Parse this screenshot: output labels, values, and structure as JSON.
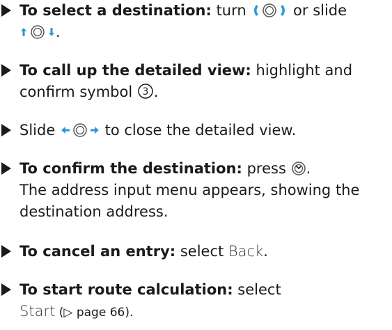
{
  "steps": [
    {
      "bold": "To select a destination:",
      "text1": " turn ",
      "text2": " or slide",
      "icon_a": "rotate-controller-icon",
      "icon_b": "slide-up-down-controller-icon",
      "end": "."
    },
    {
      "bold": "To call up the detailed view:",
      "text1": " highlight and confirm symbol ",
      "num": "3",
      "end": "."
    },
    {
      "text1": "Slide ",
      "icon_a": "slide-left-right-controller-icon",
      "text2": " to close the detailed view."
    },
    {
      "bold": "To confirm the destination:",
      "text1": " press ",
      "icon_a": "press-controller-icon",
      "end": ".",
      "sub": "The address input menu appears, showing the destination address."
    },
    {
      "bold": "To cancel an entry:",
      "text1": " select ",
      "mono": "Back",
      "end": "."
    },
    {
      "bold": "To start route calculation:",
      "text1": " select",
      "mono": "Start",
      "ref": " (▷ page 66)."
    }
  ],
  "colors": {
    "accent": "#2a9ad8",
    "text": "#1a1a1a"
  }
}
